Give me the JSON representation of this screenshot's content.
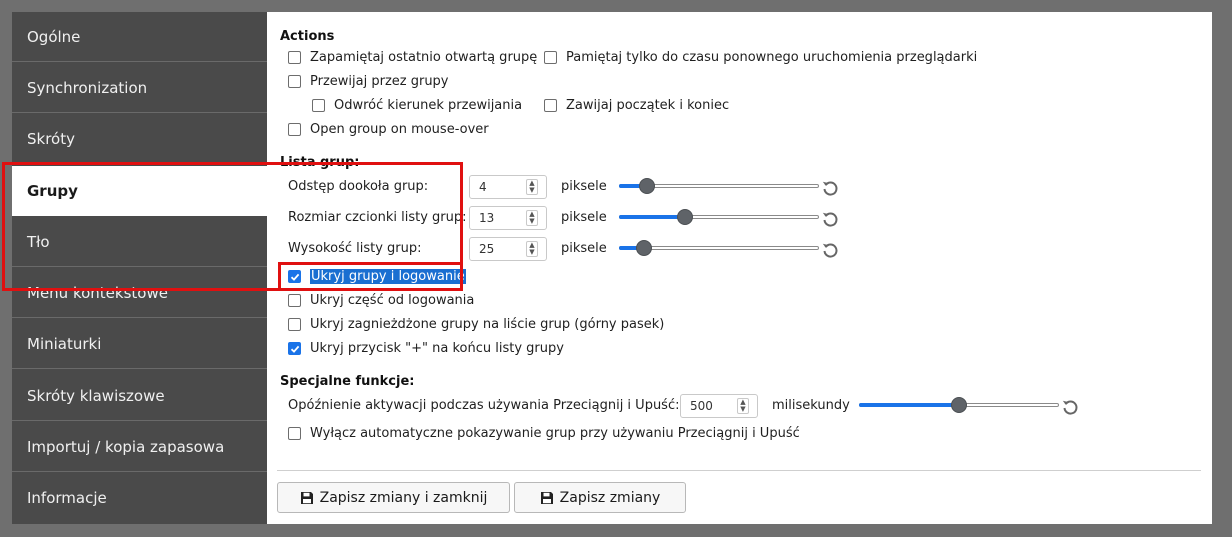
{
  "sidebar": {
    "items": [
      {
        "label": "Ogólne"
      },
      {
        "label": "Synchronization"
      },
      {
        "label": "Skróty"
      },
      {
        "label": "Grupy"
      },
      {
        "label": "Tło"
      },
      {
        "label": "Menu kontekstowe"
      },
      {
        "label": "Miniaturki"
      },
      {
        "label": "Skróty klawiszowe"
      },
      {
        "label": "Importuj / kopia zapasowa"
      },
      {
        "label": "Informacje"
      }
    ],
    "active_index": 3
  },
  "actions": {
    "title": "Actions",
    "remember_group": "Zapamiętaj ostatnio otwartą grupę",
    "remember_until_restart": "Pamiętaj tylko do czasu ponownego uruchomienia przeglądarki",
    "scroll_groups": "Przewijaj przez grupy",
    "reverse_scroll": "Odwróć kierunek przewijania",
    "wrap_around": "Zawijaj początek i koniec",
    "open_on_hover": "Open group on mouse-over"
  },
  "group_list": {
    "title": "Lista grup:",
    "spacing": {
      "label": "Odstęp dookoła grup:",
      "value": "4",
      "unit": "piksele",
      "fraction": 0.14
    },
    "font_size": {
      "label": "Rozmiar czcionki listy grup:",
      "value": "13",
      "unit": "piksele",
      "fraction": 0.33
    },
    "height": {
      "label": "Wysokość listy grup:",
      "value": "25",
      "unit": "piksele",
      "fraction": 0.125
    },
    "hide_groups_login": "Ukryj grupy i logowanie",
    "hide_part_login": "Ukryj część od logowania",
    "hide_nested": "Ukryj zagnieżdżone grupy na liście grup (górny pasek)",
    "hide_plus": "Ukryj przycisk \"+\" na końcu listy grupy"
  },
  "special": {
    "title": "Specjalne funkcje:",
    "delay": {
      "label": "Opóźnienie aktywacji podczas używania Przeciągnij i Upuść:",
      "value": "500",
      "unit": "milisekundy",
      "fraction": 0.5
    },
    "disable_auto_show": "Wyłącz automatyczne pokazywanie grup przy używaniu Przeciągnij i Upuść"
  },
  "buttons": {
    "save_close": "Zapisz zmiany i zamknij",
    "save": "Zapisz zmiany"
  },
  "colors": {
    "accent": "#1a73e8",
    "highlight_box": "#e01010",
    "sidebar_bg": "#4a4a4a"
  }
}
